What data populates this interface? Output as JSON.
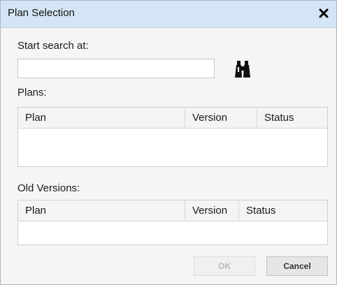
{
  "dialog": {
    "title": "Plan Selection",
    "close_icon": "close-icon"
  },
  "search": {
    "label": "Start search at:",
    "value": "",
    "placeholder": "",
    "icon": "binoculars-icon"
  },
  "plans": {
    "label": "Plans:",
    "columns": [
      "Plan",
      "Version",
      "Status"
    ],
    "rows": []
  },
  "old_versions": {
    "label": "Old Versions:",
    "columns": [
      "Plan",
      "Version",
      "Status"
    ],
    "rows": []
  },
  "buttons": {
    "ok": "OK",
    "cancel": "Cancel"
  },
  "colors": {
    "titlebar": "#d4e5f5",
    "dialog_bg": "#f5f5f5"
  }
}
